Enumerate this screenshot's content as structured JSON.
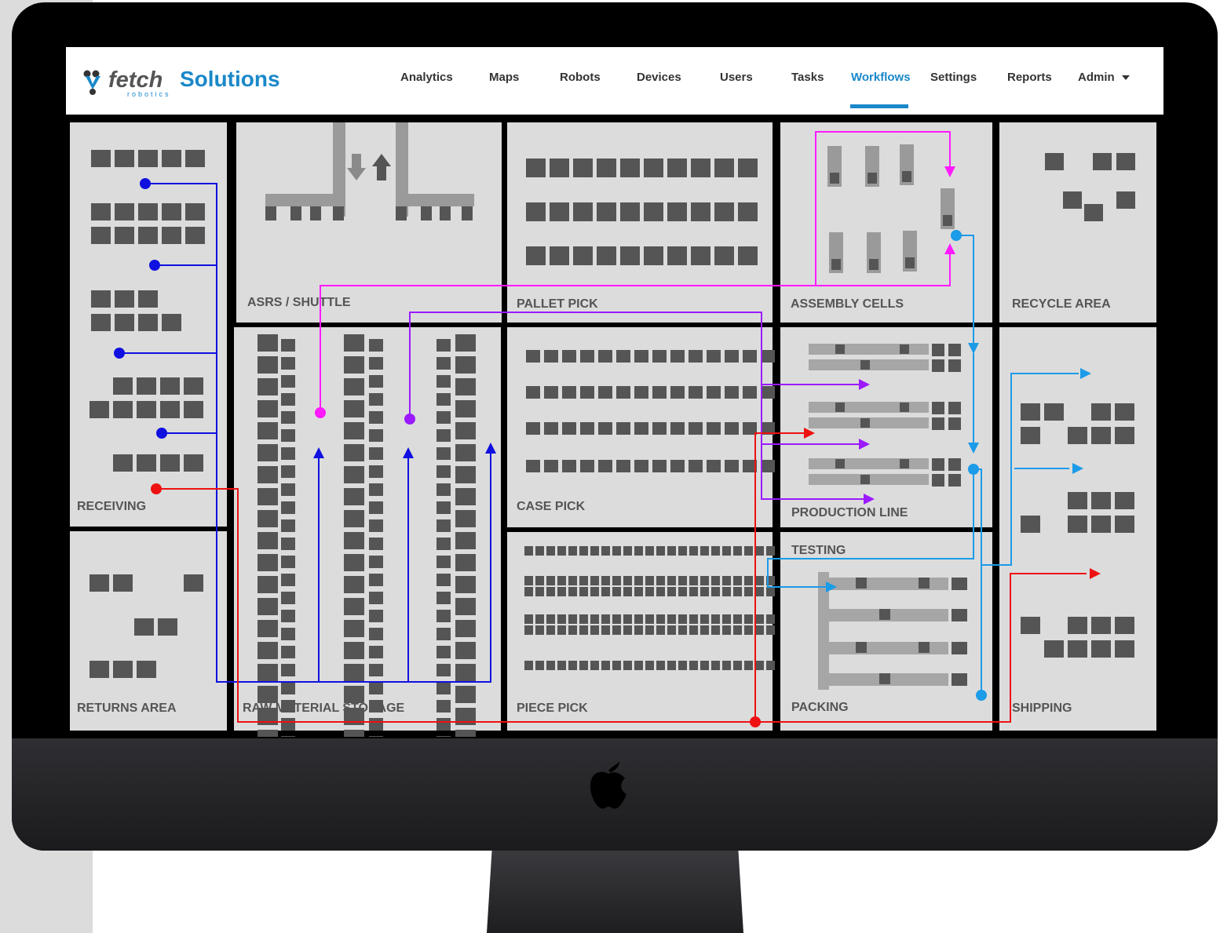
{
  "app": {
    "logo_text": "fetch",
    "logo_subtext": "robotics",
    "title": "Solutions"
  },
  "nav": {
    "items": [
      "Analytics",
      "Maps",
      "Robots",
      "Devices",
      "Users",
      "Tasks",
      "Workflows",
      "Settings",
      "Reports",
      "Admin"
    ],
    "active": "Workflows"
  },
  "zones": {
    "receiving": "RECEIVING",
    "returns_area": "RETURNS AREA",
    "asrs_shuttle": "ASRS / SHUTTLE",
    "raw_material_storage": "RAW MATERIAL STORAGE",
    "pallet_pick": "PALLET PICK",
    "case_pick": "CASE PICK",
    "piece_pick": "PIECE PICK",
    "assembly_cells": "ASSEMBLY CELLS",
    "production_line": "PRODUCTION LINE",
    "testing": "TESTING",
    "packing": "PACKING",
    "recycle_area": "RECYCLE AREA",
    "shipping": "SHIPPING"
  },
  "route_colors": {
    "blue": "#1010e0",
    "magenta": "#ff1aff",
    "purple": "#9b1aff",
    "red": "#ee1111",
    "cyan": "#1b9be8"
  },
  "colors": {
    "accent": "#1a88c9",
    "zone_fill": "#dcdcdc",
    "rack": "#555555"
  },
  "icons": {
    "admin_caret": "caret-down-icon",
    "apple_logo": "apple-logo-icon"
  }
}
